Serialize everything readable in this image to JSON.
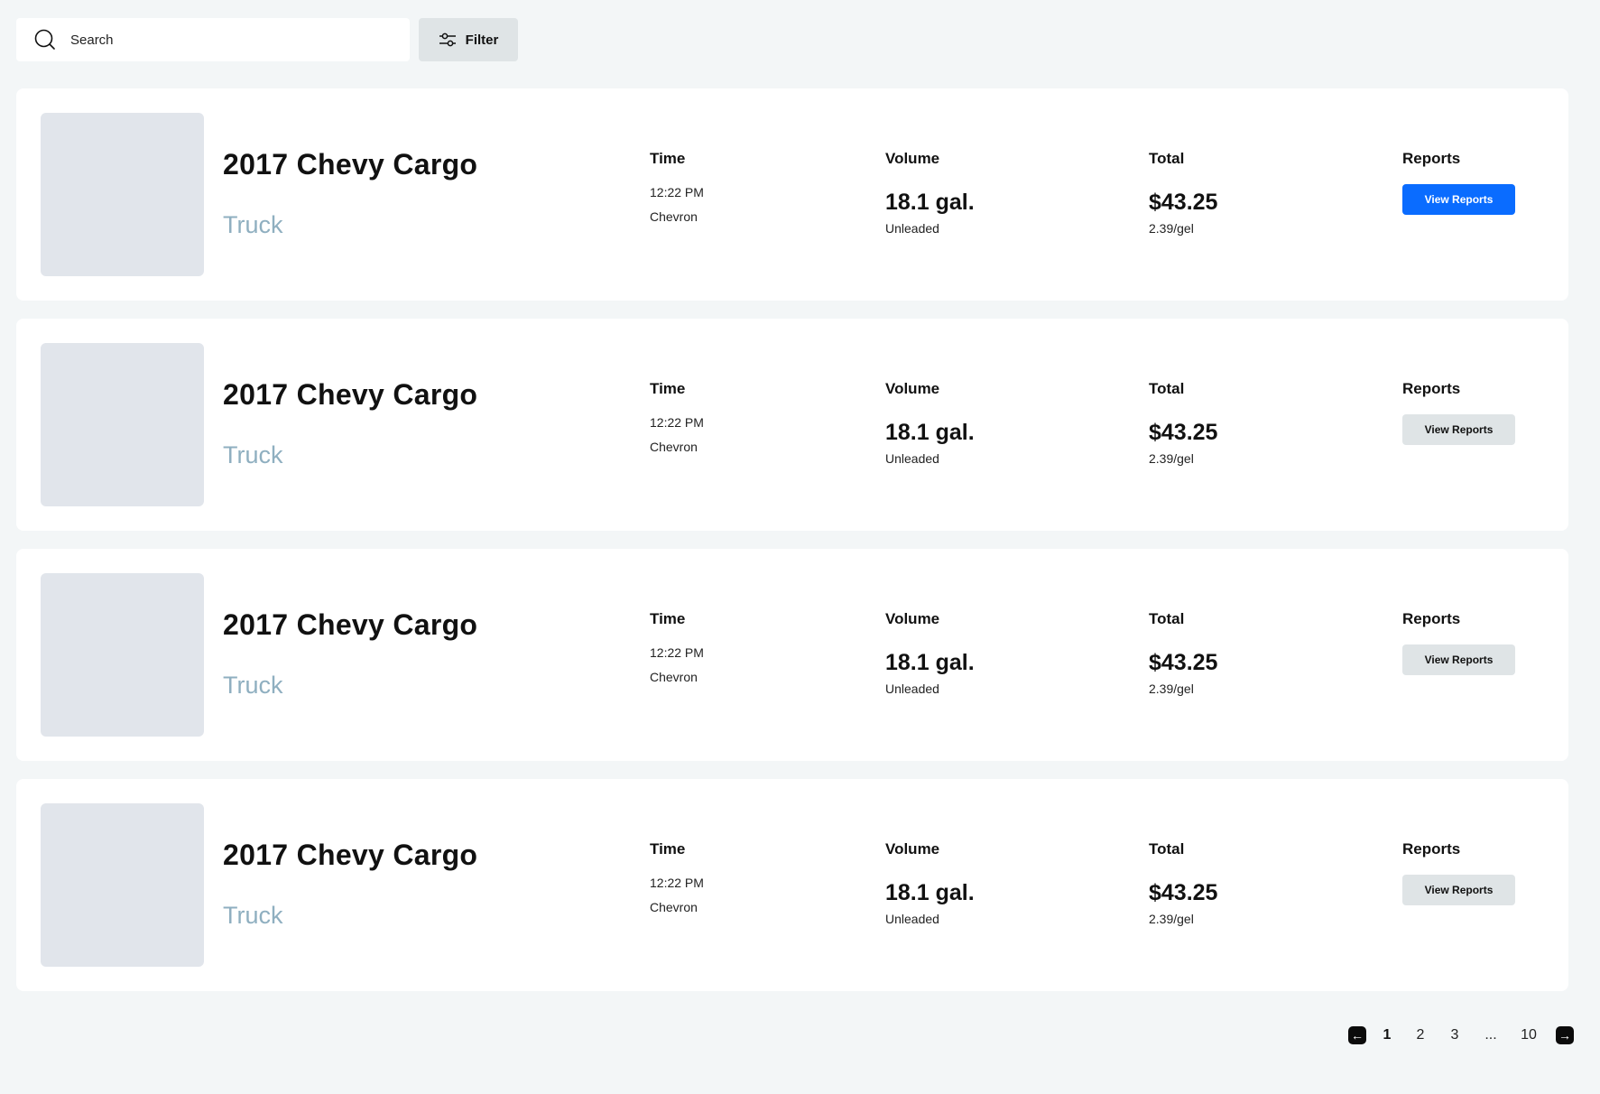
{
  "search": {
    "placeholder": "Search"
  },
  "filter": {
    "label": "Filter"
  },
  "columns": {
    "time": "Time",
    "volume": "Volume",
    "total": "Total",
    "reports": "Reports"
  },
  "records": [
    {
      "title": "2017 Chevy Cargo",
      "type": "Truck",
      "time": "12:22 PM",
      "station": "Chevron",
      "volume": "18.1 gal.",
      "fuel": "Unleaded",
      "total": "$43.25",
      "rate": "2.39/gel",
      "button": "View Reports"
    },
    {
      "title": "2017 Chevy Cargo",
      "type": "Truck",
      "time": "12:22 PM",
      "station": "Chevron",
      "volume": "18.1 gal.",
      "fuel": "Unleaded",
      "total": "$43.25",
      "rate": "2.39/gel",
      "button": "View Reports"
    },
    {
      "title": "2017 Chevy Cargo",
      "type": "Truck",
      "time": "12:22 PM",
      "station": "Chevron",
      "volume": "18.1 gal.",
      "fuel": "Unleaded",
      "total": "$43.25",
      "rate": "2.39/gel",
      "button": "View Reports"
    },
    {
      "title": "2017 Chevy Cargo",
      "type": "Truck",
      "time": "12:22 PM",
      "station": "Chevron",
      "volume": "18.1 gal.",
      "fuel": "Unleaded",
      "total": "$43.25",
      "rate": "2.39/gel",
      "button": "View Reports"
    }
  ],
  "pagination": {
    "pages": [
      "1",
      "2",
      "3",
      "...",
      "10"
    ],
    "current": "1"
  },
  "colors": {
    "primary_button": "#0a6cff",
    "secondary_button": "#dfe4e6",
    "subtitle": "#8fafc0",
    "background": "#f3f6f7"
  }
}
